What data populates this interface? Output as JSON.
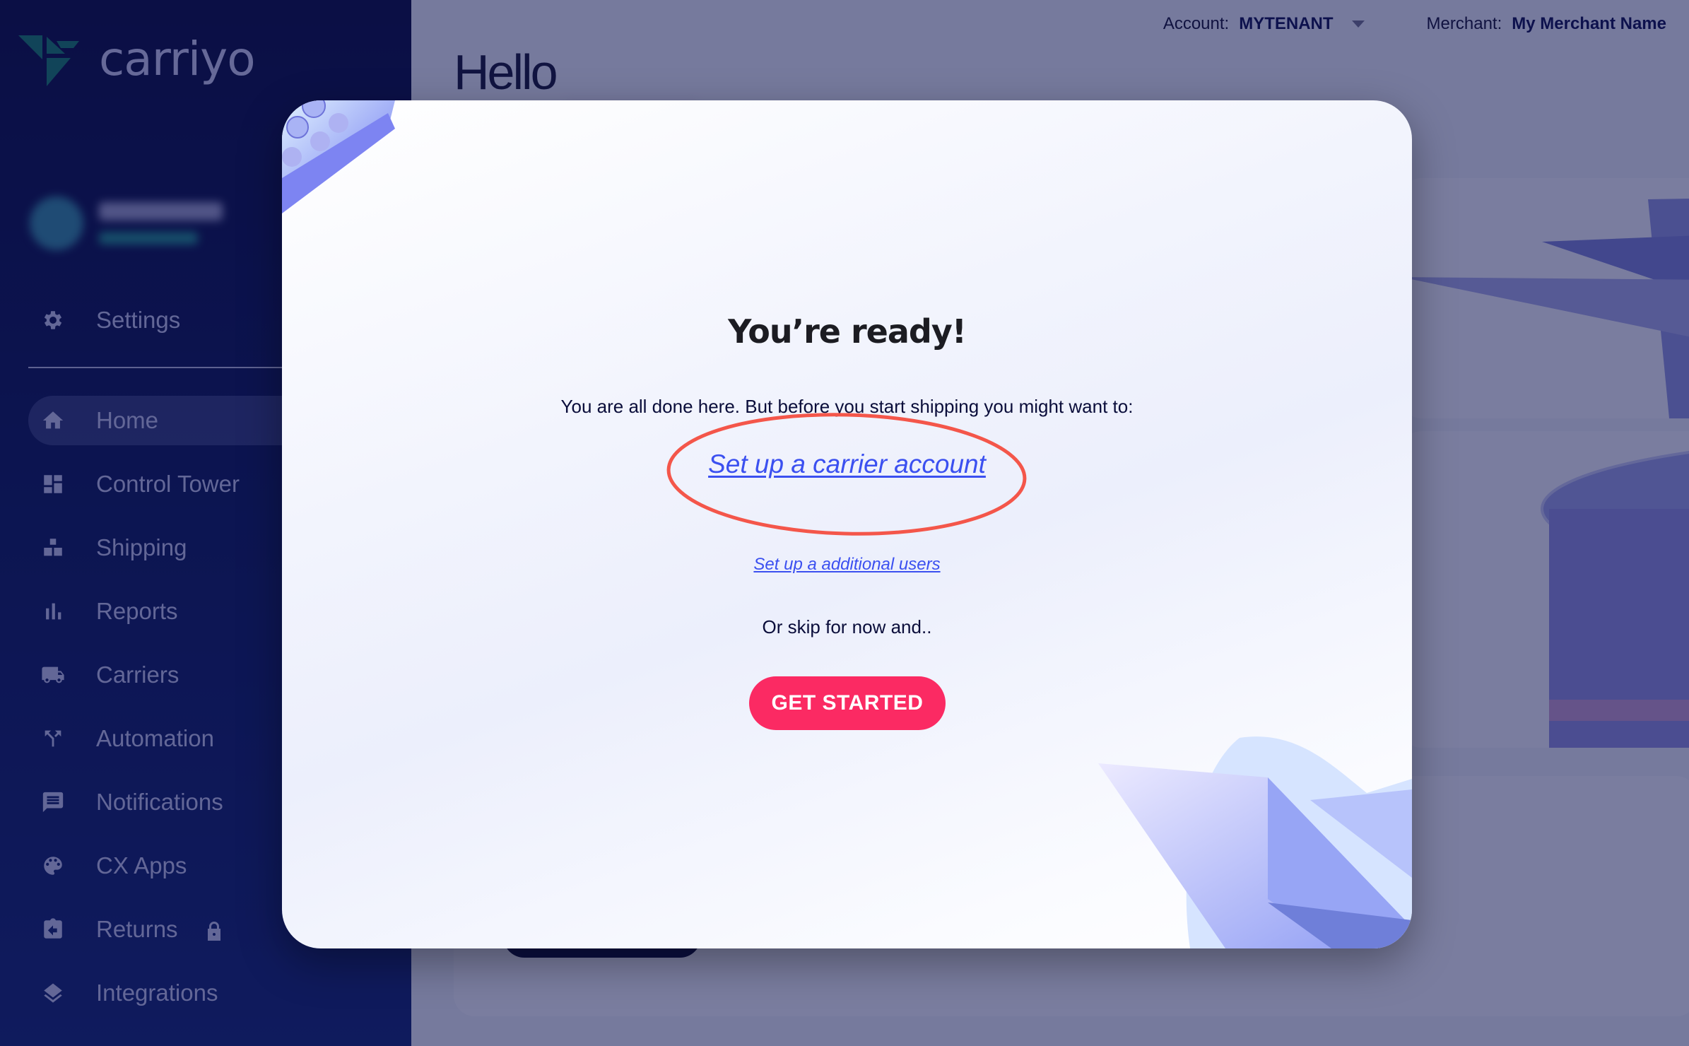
{
  "brand": {
    "name": "carriyo"
  },
  "sidebar": {
    "settings_label": "Settings",
    "items": [
      {
        "label": "Home",
        "icon": "home-icon",
        "active": true
      },
      {
        "label": "Control Tower",
        "icon": "dashboard-icon",
        "active": false
      },
      {
        "label": "Shipping",
        "icon": "boxes-icon",
        "active": false
      },
      {
        "label": "Reports",
        "icon": "bar-chart-icon",
        "active": false
      },
      {
        "label": "Carriers",
        "icon": "truck-icon",
        "active": false
      },
      {
        "label": "Automation",
        "icon": "merge-arrows-icon",
        "active": false
      },
      {
        "label": "Notifications",
        "icon": "message-icon",
        "active": false
      },
      {
        "label": "CX Apps",
        "icon": "palette-icon",
        "active": false
      },
      {
        "label": "Returns",
        "icon": "return-clipboard-icon",
        "active": false,
        "locked": true
      },
      {
        "label": "Integrations",
        "icon": "layers-icon",
        "active": false
      }
    ]
  },
  "header": {
    "account_label": "Account:",
    "account_value": "MYTENANT",
    "merchant_label": "Merchant:",
    "merchant_value": "My Merchant Name",
    "greeting": "Hello"
  },
  "modal": {
    "title": "You’re ready!",
    "subtitle": "You are all done here. But before you start shipping you might want to:",
    "link_carrier": "Set up a carrier account",
    "link_users": "Set up a additional users",
    "skip_text": "Or skip for now and..",
    "cta_label": "GET STARTED"
  },
  "colors": {
    "sidebar_bg": "#010538",
    "accent_pink": "#fb2a63",
    "link_blue": "#3b50f0",
    "annotation_red": "#f4564a",
    "logo_green": "#0f7b64"
  }
}
